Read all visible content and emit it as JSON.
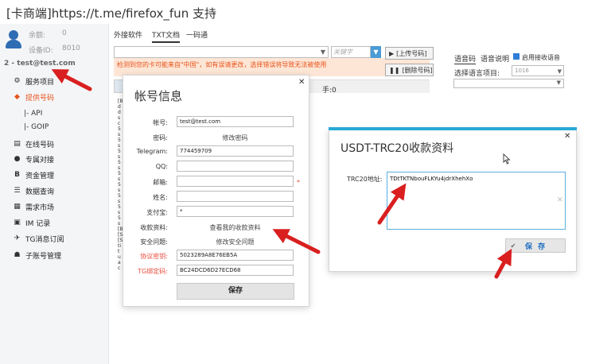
{
  "app": {
    "title": "[卡商端]https://t.me/firefox_fun 支持"
  },
  "sidebar": {
    "balance_label": "余额:",
    "balance_value": "0",
    "device_label": "设备ID:",
    "device_value": "8010",
    "account": "2 - test@test.com",
    "items": [
      {
        "label": "服务项目",
        "icon": "gear-icon",
        "glyph": "⚙"
      },
      {
        "label": "提供号码",
        "icon": "diamond-icon",
        "glyph": "◆"
      },
      {
        "label": "|- API"
      },
      {
        "label": "|- GOIP"
      },
      {
        "label": "在线号码",
        "icon": "list-icon",
        "glyph": "▤"
      },
      {
        "label": "专属对接",
        "icon": "badge-icon",
        "glyph": "●"
      },
      {
        "label": "资金管理",
        "icon": "bitcoin-icon",
        "glyph": "B"
      },
      {
        "label": "数据查询",
        "icon": "list-lines-icon",
        "glyph": "☰"
      },
      {
        "label": "需求市场",
        "icon": "market-icon",
        "glyph": "▦"
      },
      {
        "label": "IM 记录",
        "icon": "chat-icon",
        "glyph": "▣"
      },
      {
        "label": "TG消息订阅",
        "icon": "telegram-icon",
        "glyph": "✈"
      },
      {
        "label": "子账号管理",
        "icon": "users-icon",
        "glyph": "☗"
      }
    ],
    "active_index": 1
  },
  "tabs": [
    {
      "label": "外接软件"
    },
    {
      "label": "TXT文档"
    },
    {
      "label": "一码通"
    }
  ],
  "active_tab": 1,
  "toolbar": {
    "search_placeholder": "关键字",
    "warning": "检测到您的卡可能来自\"中国\"，如有误请更改，选择错误将导致无法被使用",
    "upload_label": "[上传号码]",
    "delete_label": "[删除号码]",
    "hand_label": "手:0"
  },
  "voice": {
    "tabs": [
      {
        "label": "语音码"
      },
      {
        "label": "语音说明"
      }
    ],
    "enable_label": "启用接收语音",
    "enabled": true,
    "lang_label": "选择语言项目:",
    "lang_value": "1016"
  },
  "account_dialog": {
    "title": "帐号信息",
    "fields": [
      {
        "label": "帐号:",
        "value": "test@test.com"
      },
      {
        "label": "密码:",
        "link": "修改密码"
      },
      {
        "label": "Telegram:",
        "value": "774459709"
      },
      {
        "label": "QQ:",
        "value": ""
      },
      {
        "label": "邮箱:",
        "value": ""
      },
      {
        "label": "姓名:",
        "value": ""
      },
      {
        "label": "支付宝:",
        "value": "*"
      },
      {
        "label": "收款资料:",
        "link": "查看我的收款资料"
      },
      {
        "label": "安全问题:",
        "link": "修改安全问题"
      },
      {
        "label": "协议密钥:",
        "value": "5023289A8E76EB5A"
      },
      {
        "label": "TG绑定码:",
        "value": "BC24DCD6D27ECD68"
      }
    ],
    "required_mark": "*",
    "save_label": "保存"
  },
  "usdt_dialog": {
    "title": "USDT-TRC20收款资料",
    "address_label": "TRC20地址:",
    "address_value": "TDtTKTNbouFLKYu4jdrXhehXo",
    "save_label": "保 存"
  },
  "colors": {
    "accent_orange": "#e8541c",
    "dialog_bar": "#29a9d6",
    "arrow_red": "#d91f1f",
    "link_blue": "#1b6ec2"
  }
}
